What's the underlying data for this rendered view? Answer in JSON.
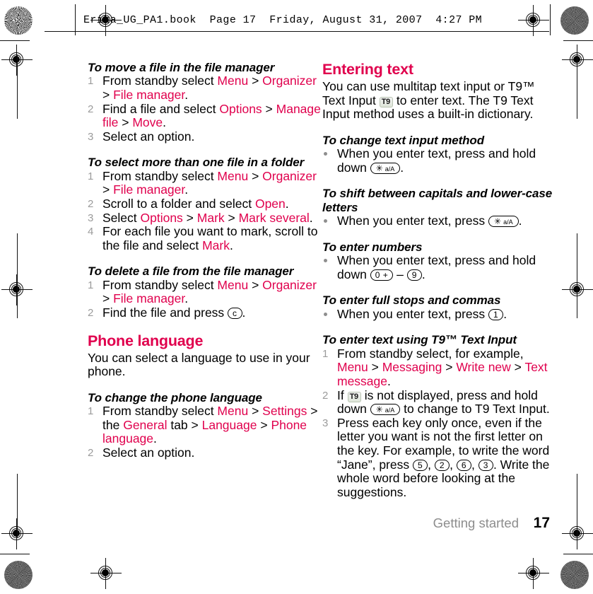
{
  "header": {
    "proof_line": "Erika_UG_PA1.book  Page 17  Friday, August 31, 2007  4:27 PM"
  },
  "colors": {
    "accent_pink": "#E0004D",
    "step_number_gray": "#9B9B9B",
    "footer_gray": "#8D8D8D",
    "body_black": "#000000"
  },
  "left_column": {
    "block1": {
      "heading": "To move a file in the file manager",
      "steps": [
        {
          "num": "1",
          "parts": [
            {
              "t": "From standby select ",
              "s": "plain"
            },
            {
              "t": "Menu",
              "s": "link"
            },
            {
              "t": " > ",
              "s": "plain"
            },
            {
              "t": "Organizer",
              "s": "link"
            },
            {
              "t": " > ",
              "s": "plain"
            },
            {
              "t": "File manager",
              "s": "link"
            },
            {
              "t": ".",
              "s": "plain"
            }
          ]
        },
        {
          "num": "2",
          "parts": [
            {
              "t": "Find a file and select ",
              "s": "plain"
            },
            {
              "t": "Options",
              "s": "link"
            },
            {
              "t": " > ",
              "s": "plain"
            },
            {
              "t": "Manage file",
              "s": "link"
            },
            {
              "t": " > ",
              "s": "plain"
            },
            {
              "t": "Move",
              "s": "link"
            },
            {
              "t": ".",
              "s": "plain"
            }
          ]
        },
        {
          "num": "3",
          "parts": [
            {
              "t": "Select an option.",
              "s": "plain"
            }
          ]
        }
      ]
    },
    "block2": {
      "heading": "To select more than one file in a folder",
      "steps": [
        {
          "num": "1",
          "parts": [
            {
              "t": "From standby select ",
              "s": "plain"
            },
            {
              "t": "Menu",
              "s": "link"
            },
            {
              "t": " > ",
              "s": "plain"
            },
            {
              "t": "Organizer",
              "s": "link"
            },
            {
              "t": " > ",
              "s": "plain"
            },
            {
              "t": "File manager",
              "s": "link"
            },
            {
              "t": ".",
              "s": "plain"
            }
          ]
        },
        {
          "num": "2",
          "parts": [
            {
              "t": "Scroll to a folder and select ",
              "s": "plain"
            },
            {
              "t": "Open",
              "s": "link"
            },
            {
              "t": ".",
              "s": "plain"
            }
          ]
        },
        {
          "num": "3",
          "parts": [
            {
              "t": "Select ",
              "s": "plain"
            },
            {
              "t": "Options",
              "s": "link"
            },
            {
              "t": " > ",
              "s": "plain"
            },
            {
              "t": "Mark",
              "s": "link"
            },
            {
              "t": " > ",
              "s": "plain"
            },
            {
              "t": "Mark several",
              "s": "link"
            },
            {
              "t": ".",
              "s": "plain"
            }
          ]
        },
        {
          "num": "4",
          "parts": [
            {
              "t": "For each file you want to mark, scroll to the file and select ",
              "s": "plain"
            },
            {
              "t": "Mark",
              "s": "link"
            },
            {
              "t": ".",
              "s": "plain"
            }
          ]
        }
      ]
    },
    "block3": {
      "heading": "To delete a file from the file manager",
      "steps": [
        {
          "num": "1",
          "parts": [
            {
              "t": "From standby select ",
              "s": "plain"
            },
            {
              "t": "Menu",
              "s": "link"
            },
            {
              "t": " > ",
              "s": "plain"
            },
            {
              "t": "Organizer",
              "s": "link"
            },
            {
              "t": " > ",
              "s": "plain"
            },
            {
              "t": "File manager",
              "s": "link"
            },
            {
              "t": ".",
              "s": "plain"
            }
          ]
        },
        {
          "num": "2",
          "parts": [
            {
              "t": "Find the file and press ",
              "s": "plain"
            },
            {
              "t": "c",
              "s": "key"
            },
            {
              "t": ".",
              "s": "plain"
            }
          ]
        }
      ]
    },
    "phone_language": {
      "section_title": "Phone language",
      "intro": "You can select a language to use in your phone.",
      "sub_heading": "To change the phone language",
      "steps": [
        {
          "num": "1",
          "parts": [
            {
              "t": "From standby select ",
              "s": "plain"
            },
            {
              "t": "Menu",
              "s": "link"
            },
            {
              "t": " > ",
              "s": "plain"
            },
            {
              "t": "Settings",
              "s": "link"
            },
            {
              "t": " > the ",
              "s": "plain"
            },
            {
              "t": "General",
              "s": "link"
            },
            {
              "t": " tab > ",
              "s": "plain"
            },
            {
              "t": "Language",
              "s": "link"
            },
            {
              "t": " > ",
              "s": "plain"
            },
            {
              "t": "Phone language",
              "s": "link"
            },
            {
              "t": ".",
              "s": "plain"
            }
          ]
        },
        {
          "num": "2",
          "parts": [
            {
              "t": "Select an option.",
              "s": "plain"
            }
          ]
        }
      ]
    }
  },
  "right_column": {
    "entering_text": {
      "section_title": "Entering text",
      "intro_parts": [
        {
          "t": "You can use multitap text input or T9™ Text Input ",
          "s": "plain"
        },
        {
          "t": "T9",
          "s": "t9badge"
        },
        {
          "t": " to enter text. The T9 Text Input method uses a built-in dictionary.",
          "s": "plain"
        }
      ]
    },
    "change_input_method": {
      "heading": "To change text input method",
      "bullets": [
        {
          "parts": [
            {
              "t": "When you enter text, press and hold down ",
              "s": "plain"
            },
            {
              "t": "✳ a/A",
              "s": "key"
            },
            {
              "t": ".",
              "s": "plain"
            }
          ]
        }
      ]
    },
    "shift_case": {
      "heading": "To shift between capitals and lower-case letters",
      "bullets": [
        {
          "parts": [
            {
              "t": "When you enter text, press ",
              "s": "plain"
            },
            {
              "t": "✳ a/A",
              "s": "key"
            },
            {
              "t": ".",
              "s": "plain"
            }
          ]
        }
      ]
    },
    "enter_numbers": {
      "heading": "To enter numbers",
      "bullets": [
        {
          "parts": [
            {
              "t": "When you enter text, press and hold down ",
              "s": "plain"
            },
            {
              "t": "0 +",
              "s": "key"
            },
            {
              "t": " – ",
              "s": "plain"
            },
            {
              "t": "9",
              "s": "key"
            },
            {
              "t": ".",
              "s": "plain"
            }
          ]
        }
      ]
    },
    "full_stops": {
      "heading": "To enter full stops and commas",
      "bullets": [
        {
          "parts": [
            {
              "t": "When you enter text, press ",
              "s": "plain"
            },
            {
              "t": "1",
              "s": "key"
            },
            {
              "t": ".",
              "s": "plain"
            }
          ]
        }
      ]
    },
    "t9_text_input": {
      "heading": "To enter text using T9™ Text Input",
      "steps": [
        {
          "num": "1",
          "parts": [
            {
              "t": "From standby select, for example, ",
              "s": "plain"
            },
            {
              "t": "Menu",
              "s": "link"
            },
            {
              "t": " > ",
              "s": "plain"
            },
            {
              "t": "Messaging",
              "s": "link"
            },
            {
              "t": " > ",
              "s": "plain"
            },
            {
              "t": "Write new",
              "s": "link"
            },
            {
              "t": " > ",
              "s": "plain"
            },
            {
              "t": "Text message",
              "s": "link"
            },
            {
              "t": ".",
              "s": "plain"
            }
          ]
        },
        {
          "num": "2",
          "parts": [
            {
              "t": "If ",
              "s": "plain"
            },
            {
              "t": "T9",
              "s": "t9badge"
            },
            {
              "t": " is not displayed, press and hold down ",
              "s": "plain"
            },
            {
              "t": "✳ a/A",
              "s": "key"
            },
            {
              "t": " to change to T9 Text Input.",
              "s": "plain"
            }
          ]
        },
        {
          "num": "3",
          "parts": [
            {
              "t": "Press each key only once, even if the letter you want is not the first letter on the key. For example, to write the word “Jane”, press ",
              "s": "plain"
            },
            {
              "t": "5",
              "s": "key"
            },
            {
              "t": ", ",
              "s": "plain"
            },
            {
              "t": "2",
              "s": "key"
            },
            {
              "t": ", ",
              "s": "plain"
            },
            {
              "t": "6",
              "s": "key"
            },
            {
              "t": ", ",
              "s": "plain"
            },
            {
              "t": "3",
              "s": "key"
            },
            {
              "t": ". Write the whole word before looking at the suggestions.",
              "s": "plain"
            }
          ]
        }
      ]
    }
  },
  "footer": {
    "breadcrumb": "Getting started",
    "page_number": "17"
  }
}
